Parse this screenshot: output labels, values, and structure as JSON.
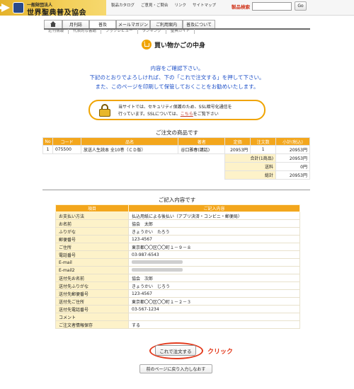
{
  "header": {
    "logo_sub": "一般財団法人",
    "logo_main": "世界聖典普及協会",
    "links": [
      "製品カタログ",
      "ご意見・ご問合",
      "リンク",
      "サイトマップ"
    ],
    "search_label": "製品検索",
    "search_value": "",
    "search_button": "Go"
  },
  "nav": {
    "tabs": [
      "月刊誌",
      "普及",
      "メールマガジン",
      "ご利用案内",
      "普及について"
    ],
    "subnav": [
      "近刊情報",
      "代表的な書籍",
      "ブックレビュー",
      "ランキング",
      "聖典ガイド"
    ]
  },
  "page": {
    "title": "買い物かごの中身",
    "intro": [
      "内容をご確認下さい。",
      "下記のとおりでよろしければ、下の「これで注文する」を押して下さい。",
      "また、このページを印刷して保管しておくことをお勧めいたします。"
    ],
    "notice_line1": "当サイトでは、セキュリティ保護のため、SSL暗号化通信を",
    "notice_line2_before": "行っています。SSLについては、",
    "notice_link": "こちら",
    "notice_line2_after": "をご覧下さい"
  },
  "order": {
    "title": "ご注文の商品です",
    "headers": [
      "No",
      "コード",
      "品名",
      "著者",
      "定価",
      "注文数",
      "小計(税込)"
    ],
    "rows": [
      {
        "no": "1",
        "code": "075500",
        "name": "放送人生読本 全10巻（ＣＤ版）",
        "author": "谷口雅春(講話)",
        "price": "20953円",
        "qty": "1",
        "subtotal": "20953円"
      }
    ],
    "summary": [
      {
        "label": "合計(1商品)",
        "value": "20953円"
      },
      {
        "label": "送料",
        "value": "0円"
      },
      {
        "label": "総計",
        "value": "20953円"
      }
    ]
  },
  "entry": {
    "title": "ご記入内容です",
    "headers": [
      "項目",
      "ご記入内容"
    ],
    "rows": [
      {
        "label": "お支払い方法",
        "value": "払込用紙による後払い（アプリ決済・コンビニ・郵便局）"
      },
      {
        "label": "お名前",
        "value": "協会　太郎"
      },
      {
        "label": "ふりがな",
        "value": "きょうかい　たろう"
      },
      {
        "label": "郵便番号",
        "value": "123-4567"
      },
      {
        "label": "ご住所",
        "value": "東京都〇〇区〇〇町１－９－８"
      },
      {
        "label": "電話番号",
        "value": "03-987-6543"
      },
      {
        "label": "E-mail",
        "value": ""
      },
      {
        "label": "E-mail2",
        "value": ""
      },
      {
        "label": "送付先お名前",
        "value": "協会　次郎"
      },
      {
        "label": "送付先ふりがな",
        "value": "きょうかい　じろう"
      },
      {
        "label": "送付先郵便番号",
        "value": "123-4567"
      },
      {
        "label": "送付先ご住所",
        "value": "東京都〇〇区〇〇町１－２－３"
      },
      {
        "label": "送付先電話番号",
        "value": "03-567-1234"
      },
      {
        "label": "コメント",
        "value": ""
      },
      {
        "label": "ご注文者情報保存",
        "value": "する"
      }
    ]
  },
  "actions": {
    "order_button": "これで注文する",
    "click_annotation": "クリック",
    "back_button": "前のページに戻り入力しなおす"
  },
  "colors": {
    "accent": "#f3a61c",
    "label_bg": "#fdf2c9",
    "link_blue": "#1e50c8",
    "annotation_red": "#e33b1e"
  }
}
